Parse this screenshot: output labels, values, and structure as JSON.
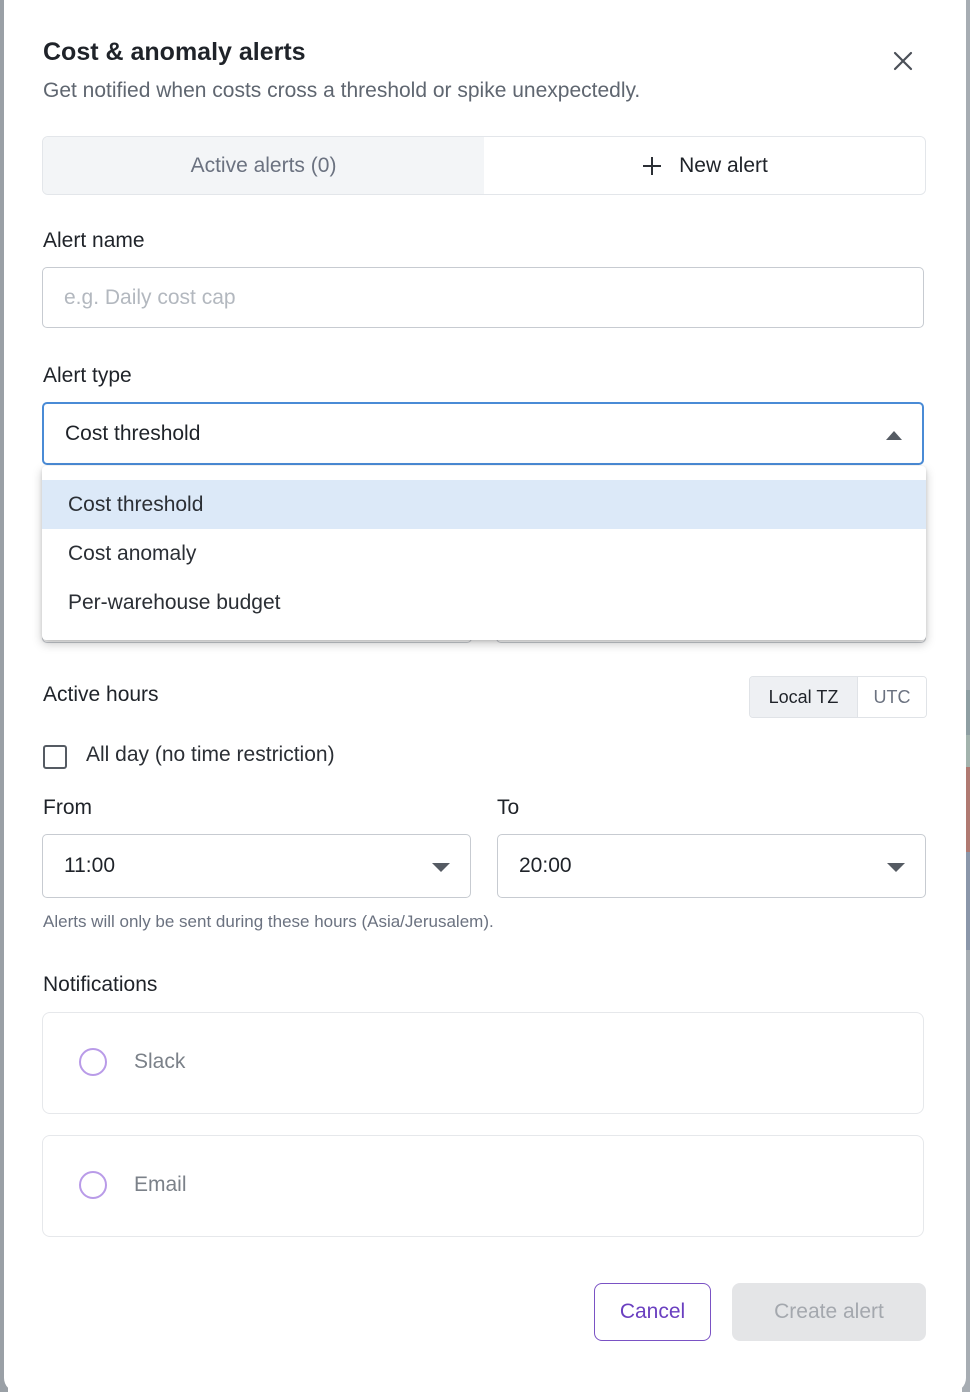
{
  "dialog": {
    "title": "Cost & anomaly alerts",
    "subtitle": "Get notified when costs cross a threshold or spike unexpectedly."
  },
  "tabs": {
    "active_alerts": "Active alerts (0)",
    "new_alert": "New alert"
  },
  "alert_name": {
    "label": "Alert name",
    "value": "",
    "placeholder": "e.g. Daily cost cap"
  },
  "alert_type": {
    "label": "Alert type",
    "selected": "Cost threshold",
    "options": [
      "Cost threshold",
      "Cost anomaly",
      "Per-warehouse budget"
    ]
  },
  "active_hours": {
    "label": "Active hours",
    "tz_options": [
      "Local TZ",
      "UTC"
    ],
    "all_day_label": "All day (no time restriction)",
    "all_day_checked": false,
    "from_label": "From",
    "from_value": "11:00",
    "to_label": "To",
    "to_value": "20:00",
    "hint": "Alerts will only be sent during these hours (Asia/Jerusalem)."
  },
  "notifications": {
    "label": "Notifications",
    "channels": [
      "Slack",
      "Email"
    ]
  },
  "footer": {
    "cancel": "Cancel",
    "create": "Create alert"
  },
  "colors": {
    "accent": "#7a52c4",
    "focus_border": "#4a8bd6",
    "selected_option_bg": "#dce9f8",
    "disabled_button_bg": "#e4e5e7"
  }
}
